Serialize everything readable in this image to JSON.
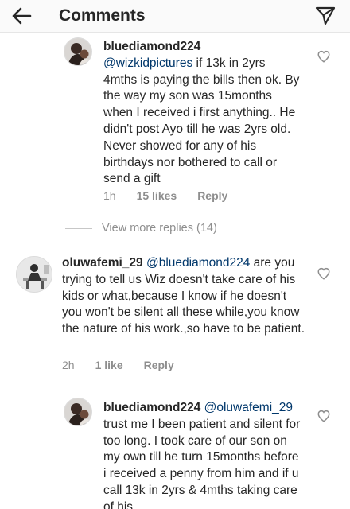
{
  "header": {
    "title": "Comments"
  },
  "comments": [
    {
      "username": "bluediamond224",
      "mention": "@wizkidpictures",
      "text": " if 13k in 2yrs 4mths is paying the bills then ok. By the way my son was 15months when I received i first anything.. He didn't post Ayo till he was 2yrs old. Never showed for any of his birthdays nor bothered to call or send a gift",
      "time": "1h",
      "likes": "15 likes",
      "reply": "Reply"
    },
    {
      "username": "oluwafemi_29",
      "mention": "@bluediamond224",
      "text": " are you trying to tell us Wiz doesn't take care of his kids or what,because I know if he doesn't you won't be silent all these while,you know the nature of his work.,so have to be patient.",
      "time": "2h",
      "likes": "1 like",
      "reply": "Reply"
    },
    {
      "username": "bluediamond224",
      "mention": "@oluwafemi_29",
      "text": " trust me I been patient and silent for too long. I took care of our son on my own till he turn 15months before i received a penny from him and if u call 13k in 2yrs & 4mths taking care of his"
    }
  ],
  "view_more": "View more replies (14)"
}
